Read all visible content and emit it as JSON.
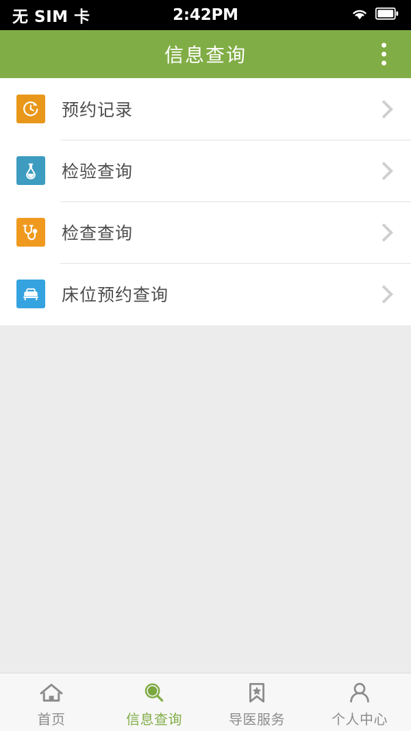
{
  "status_bar": {
    "carrier": "无 SIM 卡",
    "time": "2:42PM",
    "icons": [
      "wifi-icon",
      "battery-icon"
    ]
  },
  "header": {
    "title": "信息查询",
    "menu_icon": "overflow-menu-icon",
    "background_color": "#81ad46",
    "title_color": "#ffffff"
  },
  "list": {
    "items": [
      {
        "label": "预约记录",
        "icon": "clock-history-icon",
        "icon_color": "#e8971a",
        "chevron": "chevron-right-icon"
      },
      {
        "label": "检验查询",
        "icon": "flask-icon",
        "icon_color": "#3d9cc0",
        "chevron": "chevron-right-icon"
      },
      {
        "label": "检查查询",
        "icon": "stethoscope-icon",
        "icon_color": "#ef9a1f",
        "chevron": "chevron-right-icon"
      },
      {
        "label": "床位预约查询",
        "icon": "bed-icon",
        "icon_color": "#35a3e0",
        "chevron": "chevron-right-icon"
      }
    ]
  },
  "tabbar": {
    "active_index": 1,
    "active_color": "#81ad46",
    "inactive_color": "#8c8c8c",
    "items": [
      {
        "label": "首页",
        "icon": "home-icon"
      },
      {
        "label": "信息查询",
        "icon": "search-icon"
      },
      {
        "label": "导医服务",
        "icon": "bookmark-star-icon"
      },
      {
        "label": "个人中心",
        "icon": "person-icon"
      }
    ]
  }
}
